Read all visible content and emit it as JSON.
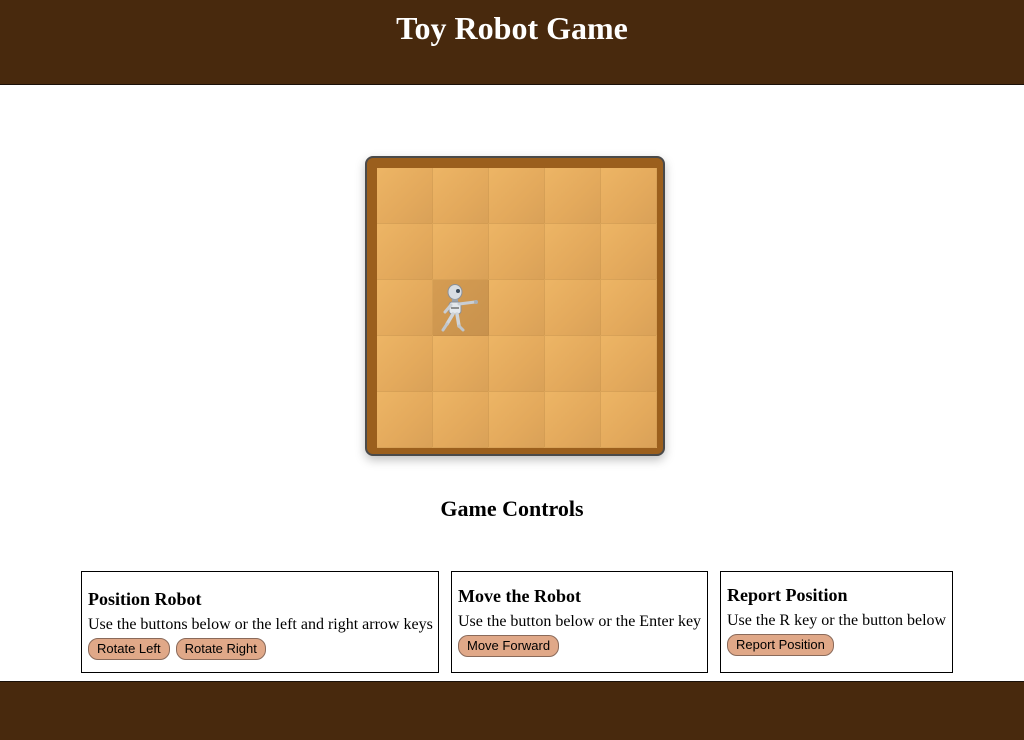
{
  "header": {
    "title": "Toy Robot Game"
  },
  "board": {
    "rows": 5,
    "cols": 5,
    "robot": {
      "row": 3,
      "col": 2,
      "facing": "east"
    },
    "colors": {
      "frame": "#9b5f1d",
      "tile": "#e3a95c",
      "robot_tile": "#c8924d"
    }
  },
  "controls": {
    "title": "Game Controls",
    "position_panel": {
      "title": "Position Robot",
      "description": "Use the buttons below or the left and right arrow keys",
      "rotate_left_label": "Rotate Left",
      "rotate_right_label": "Rotate Right"
    },
    "move_panel": {
      "title": "Move the Robot",
      "description": "Use the button below or the Enter key",
      "move_forward_label": "Move Forward"
    },
    "report_panel": {
      "title": "Report Position",
      "description": "Use the R key or the button below",
      "report_label": "Report Position"
    }
  },
  "colors": {
    "header": "#48290d",
    "footer": "#48290d",
    "button": "#e0a888"
  }
}
